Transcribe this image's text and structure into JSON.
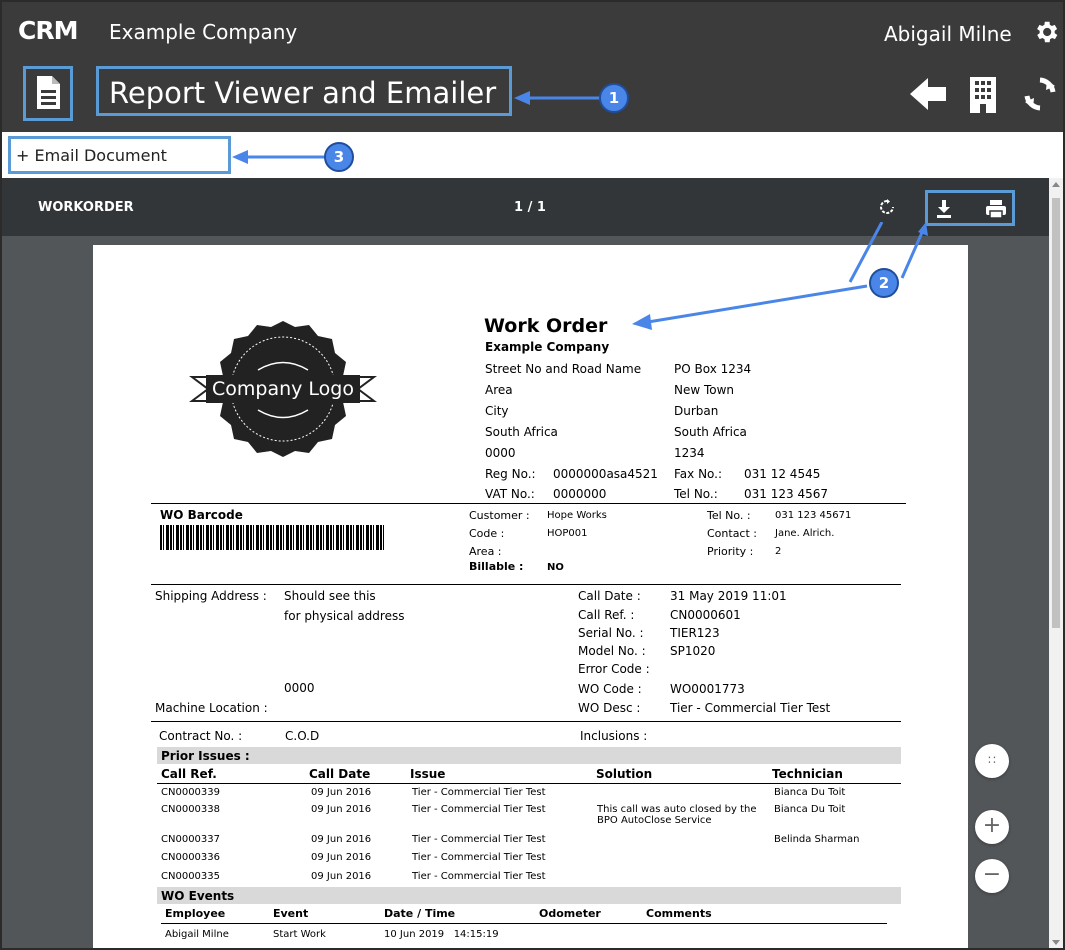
{
  "app": {
    "logo": "CRM",
    "company": "Example Company",
    "user": "Abigail Milne",
    "title": "Report Viewer and Emailer"
  },
  "toolbar": {
    "email_label": "+ Email Document"
  },
  "callouts": [
    "1",
    "2",
    "3"
  ],
  "viewer": {
    "title": "WORKORDER",
    "page": "1 / 1"
  },
  "report": {
    "logo_text": "Company Logo",
    "heading": "Work Order",
    "company": "Example Company",
    "address_left": [
      "Street No and Road Name",
      "Area",
      "City",
      "South Africa",
      "0000"
    ],
    "address_right": [
      "PO Box 1234",
      "New Town",
      "Durban",
      "South Africa",
      "1234"
    ],
    "reg_label": "Reg No.:",
    "reg_value": "0000000asa4521",
    "fax_label": "Fax No.:",
    "fax_value": "031 12 4545",
    "vat_label": "VAT No.:",
    "vat_value": "0000000",
    "tel_label": "Tel No.:",
    "tel_value": "031 123 4567",
    "barcode_label": "WO Barcode",
    "customer_label": "Customer :",
    "customer_value": "Hope Works",
    "code_label": "Code :",
    "code_value": "HOP001",
    "area_label": "Area :",
    "billable_label": "Billable :",
    "billable_value": "NO",
    "ctel_label": "Tel No. :",
    "ctel_value": "031 123 45671",
    "contact_label": "Contact :",
    "contact_value": "Jane. Alrich.",
    "priority_label": "Priority :",
    "priority_value": "2",
    "shipping_label": "Shipping Address :",
    "shipping_line1": "Should see this",
    "shipping_line2": "for physical address",
    "postal": "0000",
    "machine_label": "Machine Location :",
    "call_date_label": "Call Date :",
    "call_date_value": "31 May 2019 11:01",
    "call_ref_label": "Call Ref. :",
    "call_ref_value": "CN0000601",
    "serial_label": "Serial No. :",
    "serial_value": "TIER123",
    "model_label": "Model No. :",
    "model_value": "SP1020",
    "error_label": "Error Code :",
    "wo_code_label": "WO Code :",
    "wo_code_value": "WO0001773",
    "wo_desc_label": "WO Desc :",
    "wo_desc_value": "Tier - Commercial Tier Test",
    "contract_label": "Contract No. :",
    "contract_value": "C.O.D",
    "inclusions_label": "Inclusions :",
    "prior_title": "Prior Issues :",
    "prior_headers": [
      "Call Ref.",
      "Call Date",
      "Issue",
      "Solution",
      "Technician"
    ],
    "prior_rows": [
      [
        "CN0000339",
        "09 Jun 2016",
        "Tier - Commercial Tier Test",
        "",
        "Bianca Du Toit"
      ],
      [
        "CN0000338",
        "09 Jun 2016",
        "Tier - Commercial Tier Test",
        "This call was auto closed by the",
        "Bianca Du Toit"
      ],
      [
        "CN0000337",
        "09 Jun 2016",
        "Tier - Commercial Tier Test",
        "",
        "Belinda Sharman"
      ],
      [
        "CN0000336",
        "09 Jun 2016",
        "Tier - Commercial Tier Test",
        "",
        ""
      ],
      [
        "CN0000335",
        "09 Jun 2016",
        "Tier - Commercial Tier Test",
        "",
        ""
      ]
    ],
    "solution_line2": "BPO AutoClose Service",
    "events_title": "WO Events",
    "events_headers": [
      "Employee",
      "Event",
      "Date / Time",
      "Odometer",
      "Comments"
    ],
    "events_row": [
      "Abigail Milne",
      "Start Work",
      "10 Jun 2019   14:15:19",
      "",
      ""
    ]
  }
}
